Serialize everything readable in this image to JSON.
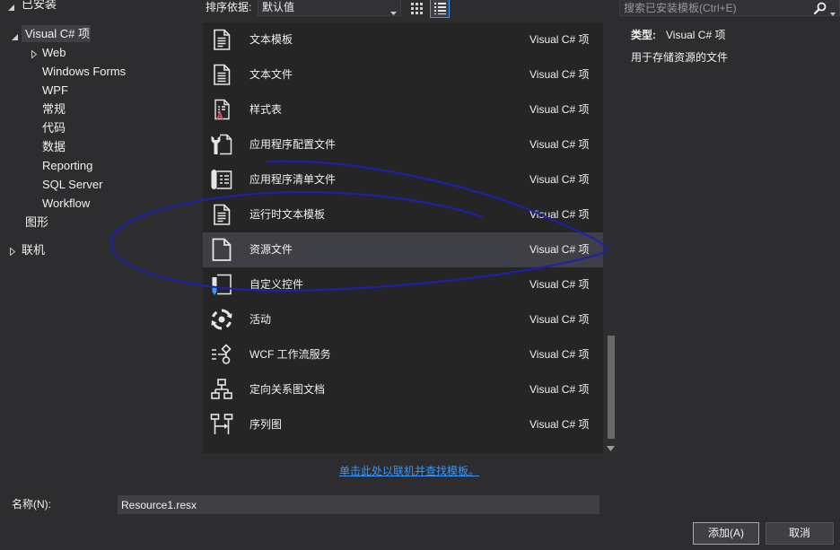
{
  "sidebar": {
    "installed": {
      "label": "已安装",
      "expanded": true,
      "items": [
        {
          "label": "Visual C# 项",
          "expanded": true,
          "selected": true,
          "children": [
            {
              "label": "Web",
              "has_children": true
            },
            {
              "label": "Windows Forms"
            },
            {
              "label": "WPF"
            },
            {
              "label": "常规"
            },
            {
              "label": "代码"
            },
            {
              "label": "数据"
            },
            {
              "label": "Reporting"
            },
            {
              "label": "SQL Server"
            },
            {
              "label": "Workflow"
            }
          ]
        },
        {
          "label": "图形"
        }
      ]
    },
    "online": {
      "label": "联机",
      "expanded": false
    }
  },
  "toolbar": {
    "sort_label": "排序依据:",
    "sort_value": "默认值",
    "list_view_selected": true,
    "search_placeholder": "搜索已安装模板(Ctrl+E)",
    "search_icon": "search-icon"
  },
  "templates": [
    {
      "name": "文本模板",
      "type": "Visual C# 项",
      "icon": "text-template-icon"
    },
    {
      "name": "文本文件",
      "type": "Visual C# 项",
      "icon": "text-file-icon"
    },
    {
      "name": "样式表",
      "type": "Visual C# 项",
      "icon": "stylesheet-icon"
    },
    {
      "name": "应用程序配置文件",
      "type": "Visual C# 项",
      "icon": "app-config-icon"
    },
    {
      "name": "应用程序清单文件",
      "type": "Visual C# 项",
      "icon": "app-manifest-icon"
    },
    {
      "name": "运行时文本模板",
      "type": "Visual C# 项",
      "icon": "runtime-text-template-icon"
    },
    {
      "name": "资源文件",
      "type": "Visual C# 项",
      "icon": "resource-file-icon",
      "selected": true
    },
    {
      "name": "自定义控件",
      "type": "Visual C# 项",
      "icon": "custom-control-icon"
    },
    {
      "name": "活动",
      "type": "Visual C# 项",
      "icon": "activity-icon"
    },
    {
      "name": "WCF 工作流服务",
      "type": "Visual C# 项",
      "icon": "wcf-workflow-service-icon"
    },
    {
      "name": "定向关系图文档",
      "type": "Visual C# 项",
      "icon": "directed-graph-icon"
    },
    {
      "name": "序列图",
      "type": "Visual C# 项",
      "icon": "sequence-diagram-icon"
    }
  ],
  "online_link": "单击此处以联机并查找模板。",
  "details": {
    "type_label": "类型:",
    "type_value": "Visual C# 项",
    "description": "用于存储资源的文件"
  },
  "name_field": {
    "label": "名称(N):",
    "value": "Resource1.resx"
  },
  "buttons": {
    "add": "添加(A)",
    "cancel": "取消"
  },
  "colors": {
    "background": "#2d2d30",
    "list_background": "#252526",
    "selection": "#3f3f46",
    "link": "#3399ff",
    "annotation_stroke": "#1f1fb0"
  }
}
